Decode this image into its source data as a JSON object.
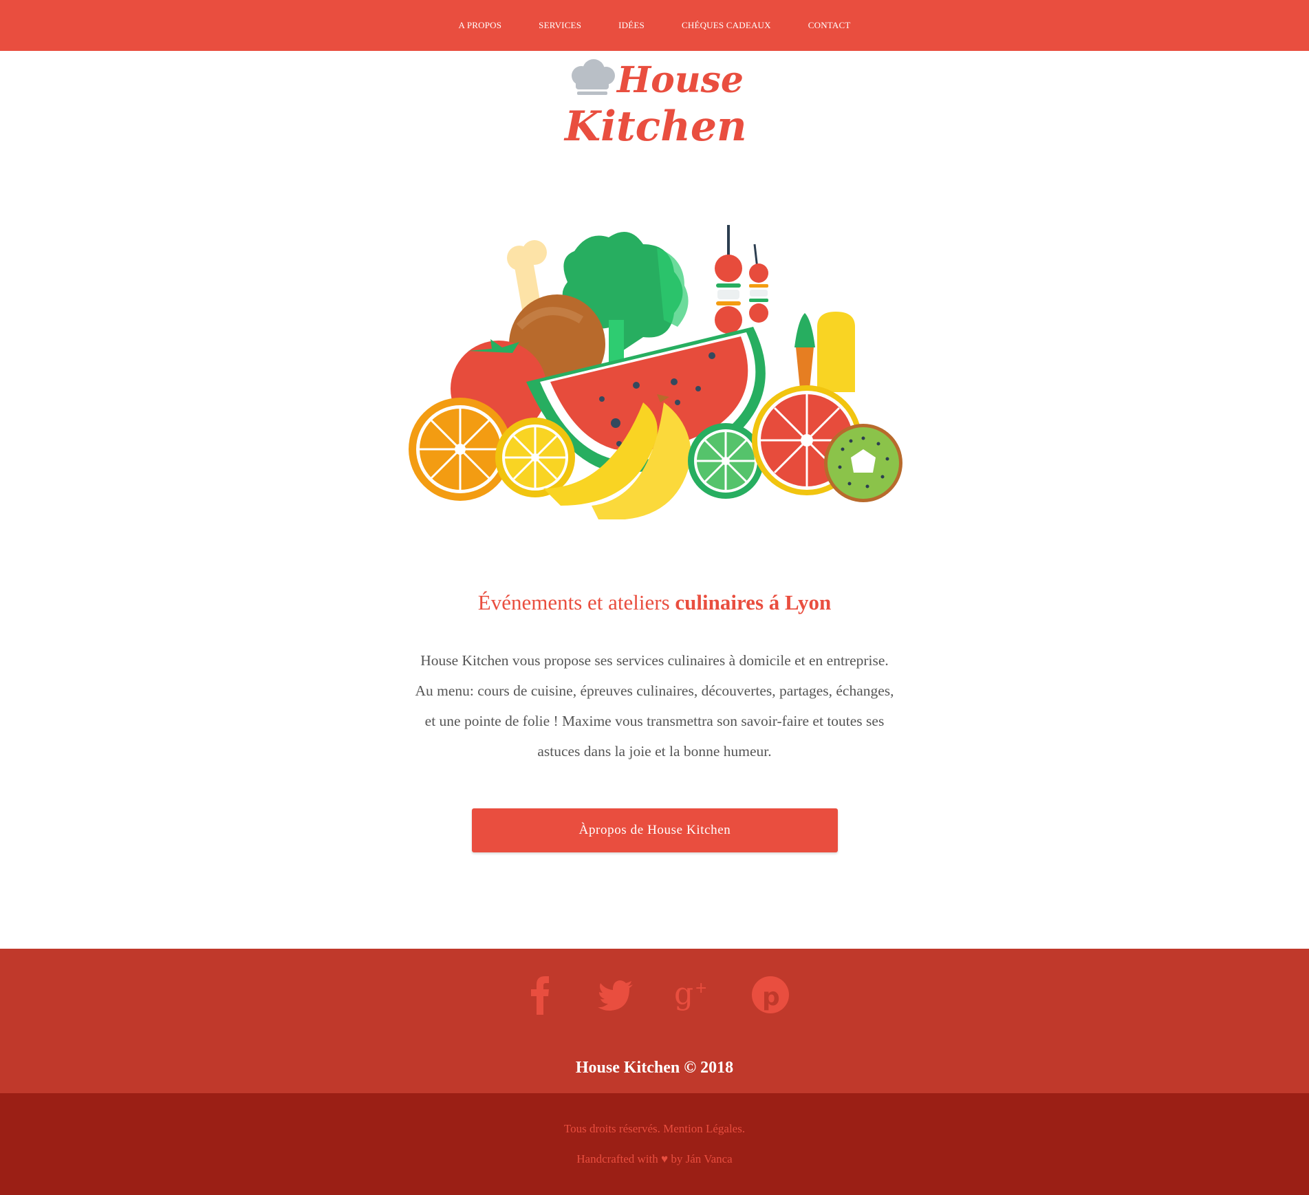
{
  "nav": {
    "items": [
      {
        "label": "A PROPOS"
      },
      {
        "label": "SERVICES"
      },
      {
        "label": "IDÉES"
      },
      {
        "label": "CHÉQUES CADEAUX"
      },
      {
        "label": "CONTACT"
      }
    ]
  },
  "logo": {
    "line1": "House",
    "line2": "Kitchen"
  },
  "hero": {
    "headline_regular": "Événements et ateliers ",
    "headline_bold": "culinaires á Lyon",
    "intro_lines": [
      "House Kitchen vous propose ses services culinaires à domicile et en entreprise.",
      "Au menu: cours de cuisine, épreuves culinaires, découvertes, partages, échanges,",
      "et une pointe de folie ! Maxime vous transmettra son savoir-faire et toutes ses",
      "astuces dans la joie et la bonne humeur."
    ],
    "button_label": "Àpropos de House Kitchen"
  },
  "footer": {
    "social": [
      "facebook-icon",
      "twitter-icon",
      "google-plus-icon",
      "pinterest-icon"
    ],
    "copyright": "House Kitchen © 2018",
    "legal": "Tous droits réservés. Mention Légales.",
    "credit": "Handcrafted with ♥ by Ján Vanca"
  },
  "colors": {
    "accent": "#e94e3f",
    "footer_top": "#c0392b",
    "footer_bottom": "#9b1f15",
    "text": "#555555"
  }
}
